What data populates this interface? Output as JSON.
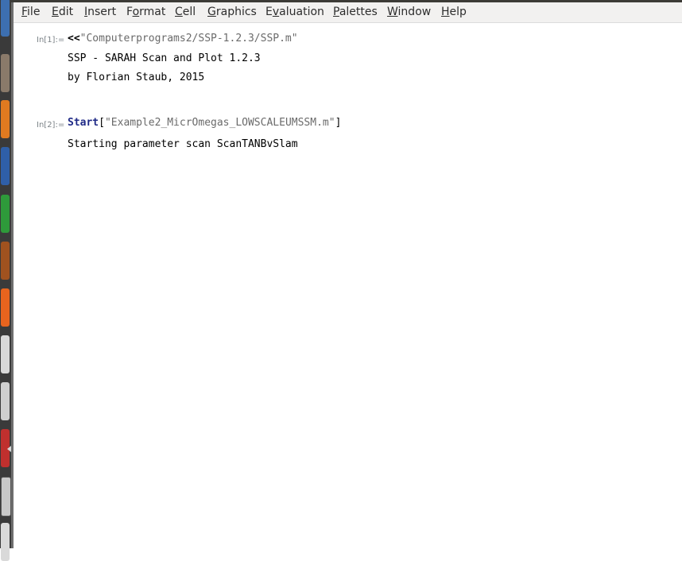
{
  "menu": {
    "items": [
      {
        "first": "F",
        "rest": "ile"
      },
      {
        "first": "E",
        "rest": "dit"
      },
      {
        "first": "I",
        "rest": "nsert"
      },
      {
        "first": "",
        "mid": "F",
        "midul": "o",
        "rest": "rmat"
      },
      {
        "first": "C",
        "rest": "ell"
      },
      {
        "first": "G",
        "rest": "raphics"
      },
      {
        "first": "",
        "mid": "E",
        "midul": "v",
        "rest": "aluation"
      },
      {
        "first": "P",
        "rest": "alettes"
      },
      {
        "first": "W",
        "rest": "indow"
      },
      {
        "first": "H",
        "rest": "elp"
      }
    ]
  },
  "cells": {
    "in1_label": "In[1]:=",
    "in1_op": "<<",
    "in1_string": "\"Computerprograms2/SSP-1.2.3/SSP.m\"",
    "out1_line1": "SSP - SARAH Scan and Plot 1.2.3",
    "out1_line2": "by Florian Staub, 2015",
    "in2_label": "In[2]:=",
    "in2_fn": "Start",
    "in2_open": "[",
    "in2_string": "\"Example2_MicrOmegas_LOWSCALEUMSSM.m\"",
    "in2_close": "]",
    "print2": "Starting parameter scan ScanTANBvSlam"
  },
  "launcher": {
    "icons": [
      {
        "name": "dash-icon",
        "color": "#3d6fb0"
      },
      {
        "name": "files-icon",
        "color": "#8a7a6a"
      },
      {
        "name": "firefox-icon",
        "color": "#e07a20"
      },
      {
        "name": "writer-icon",
        "color": "#2f5fa8"
      },
      {
        "name": "calc-icon",
        "color": "#2e9a3a"
      },
      {
        "name": "impress-icon",
        "color": "#a0521f"
      },
      {
        "name": "software-center-icon",
        "color": "#e8641e"
      },
      {
        "name": "text-editor-icon",
        "color": "#d8d8d8"
      },
      {
        "name": "settings-icon",
        "color": "#cfcfcf"
      },
      {
        "name": "mathematica-icon",
        "color": "#c0302e"
      },
      {
        "name": "terminal-icon",
        "color": "#c8c8c8"
      },
      {
        "name": "trash-icon",
        "color": "#d9d9d9"
      }
    ]
  }
}
